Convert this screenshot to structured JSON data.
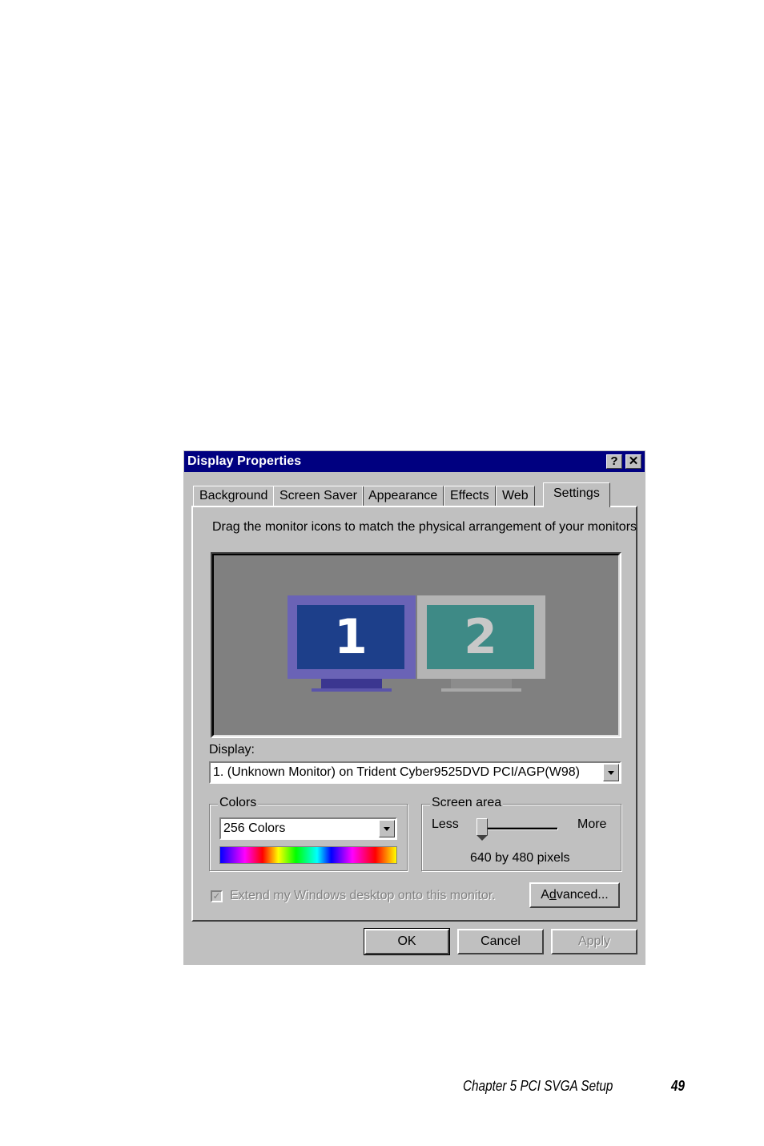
{
  "window": {
    "title": "Display Properties",
    "help_button": "?",
    "close_button": "✕"
  },
  "tabs": [
    {
      "label": "Background",
      "active": false
    },
    {
      "label": "Screen Saver",
      "active": false
    },
    {
      "label": "Appearance",
      "active": false
    },
    {
      "label": "Effects",
      "active": false
    },
    {
      "label": "Web",
      "active": false
    },
    {
      "label": "Settings",
      "active": true
    }
  ],
  "settings": {
    "instruction": "Drag the monitor icons to match the physical arrangement of your monitors",
    "monitors": [
      {
        "number": "1",
        "selected": true
      },
      {
        "number": "2",
        "selected": false
      }
    ],
    "display_label": "Display:",
    "display_value": "1. (Unknown Monitor) on Trident Cyber9525DVD PCI/AGP(W98)",
    "colors": {
      "group_title": "Colors",
      "value": "256 Colors"
    },
    "screen_area": {
      "group_title": "Screen area",
      "less_label": "Less",
      "more_label": "More",
      "resolution_text": "640 by 480 pixels",
      "slider_position_fraction": 0.0
    },
    "extend_checkbox": {
      "label": "Extend my Windows desktop onto this monitor.",
      "checked": true,
      "enabled": false
    },
    "advanced_button": {
      "pre": "A",
      "accel": "d",
      "post": "vanced..."
    }
  },
  "buttons": {
    "ok": "OK",
    "cancel": "Cancel",
    "apply": "Apply"
  },
  "page_footer": {
    "chapter": "Chapter 5  PCI SVGA Setup",
    "page_number": "49"
  }
}
